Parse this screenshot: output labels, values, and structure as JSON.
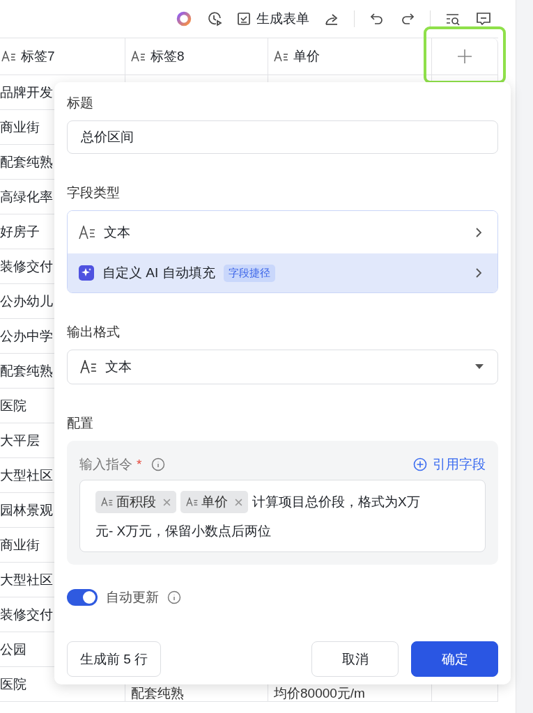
{
  "toolbar": {
    "form_button": "生成表单"
  },
  "table": {
    "columns": [
      {
        "label": "标签7"
      },
      {
        "label": "标签8"
      },
      {
        "label": "单价"
      }
    ],
    "rows": [
      {
        "column_1": "品牌开发"
      },
      {
        "column_1": "商业街"
      },
      {
        "column_1": "配套纯熟"
      },
      {
        "column_1": "高绿化率"
      },
      {
        "column_1": "好房子"
      },
      {
        "column_1": "装修交付"
      },
      {
        "column_1": "公办幼儿"
      },
      {
        "column_1": "公办中学"
      },
      {
        "column_1": "配套纯熟"
      },
      {
        "column_1": "医院"
      },
      {
        "column_1": "大平层"
      },
      {
        "column_1": "大型社区"
      },
      {
        "column_1": "园林景观"
      },
      {
        "column_1": "商业街"
      },
      {
        "column_1": "大型社区"
      },
      {
        "column_1": "装修交付"
      },
      {
        "column_1": "公园"
      },
      {
        "column_1": "医院",
        "column_2": "配套纯熟",
        "column_3": "均价80000元/m"
      }
    ]
  },
  "panel": {
    "title_label": "标题",
    "title_value": "总价区间",
    "field_type_label": "字段类型",
    "field_type_options": [
      {
        "kind": "text",
        "label": "文本",
        "selected": false
      },
      {
        "kind": "ai",
        "label": "自定义 AI 自动填充",
        "badge": "字段捷径",
        "selected": true
      }
    ],
    "output_format_label": "输出格式",
    "output_format_value": "文本",
    "config_label": "配置",
    "instruction": {
      "label": "输入指令",
      "required_mark": "*",
      "reference_link": "引用字段",
      "tokens": [
        "面积段",
        "单价"
      ],
      "text_lines": [
        "计算项目总价段，格式为X万",
        "元- X万元，保留小数点后两位"
      ]
    },
    "auto_update": {
      "label": "自动更新",
      "on": true
    },
    "buttons": {
      "preview": "生成前 5 行",
      "cancel": "取消",
      "confirm": "确定"
    }
  }
}
